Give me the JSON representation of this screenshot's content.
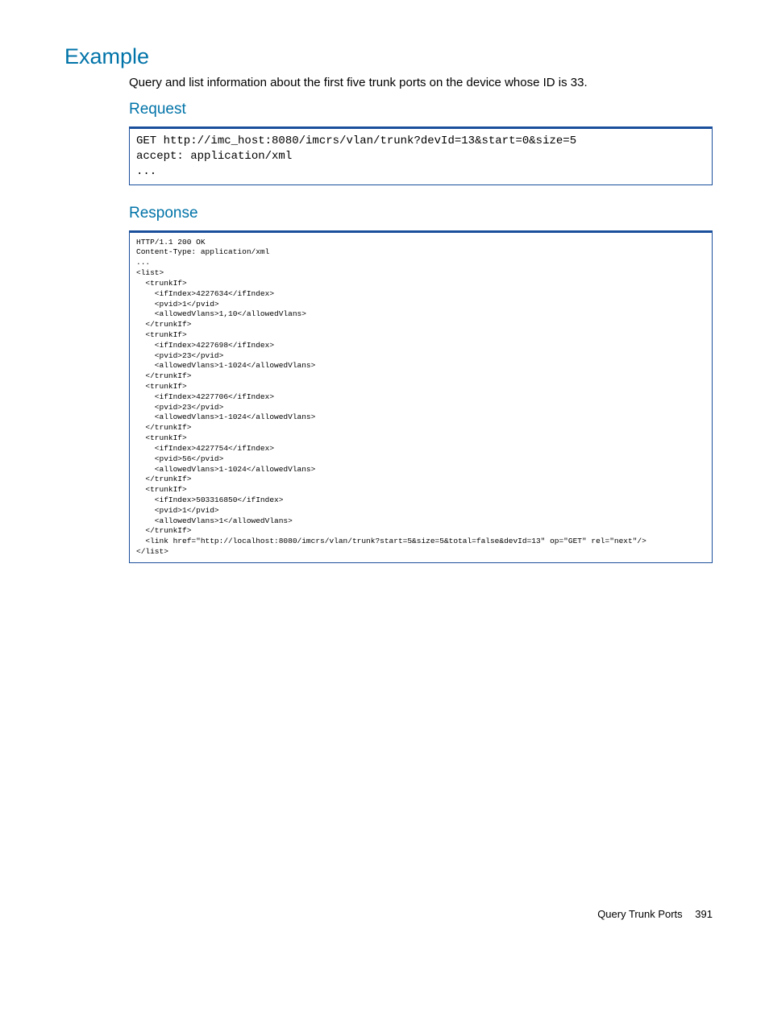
{
  "headings": {
    "example": "Example",
    "request": "Request",
    "response": "Response"
  },
  "intro": "Query and list information about the first five trunk ports on the device whose ID is 33.",
  "requestCode": "GET http://imc_host:8080/imcrs/vlan/trunk?devId=13&start=0&size=5\naccept: application/xml\n...",
  "responseCode": "HTTP/1.1 200 OK\nContent-Type: application/xml\n...\n<list>\n  <trunkIf>\n    <ifIndex>4227634</ifIndex>\n    <pvid>1</pvid>\n    <allowedVlans>1,10</allowedVlans>\n  </trunkIf>\n  <trunkIf>\n    <ifIndex>4227698</ifIndex>\n    <pvid>23</pvid>\n    <allowedVlans>1-1024</allowedVlans>\n  </trunkIf>\n  <trunkIf>\n    <ifIndex>4227706</ifIndex>\n    <pvid>23</pvid>\n    <allowedVlans>1-1024</allowedVlans>\n  </trunkIf>\n  <trunkIf>\n    <ifIndex>4227754</ifIndex>\n    <pvid>56</pvid>\n    <allowedVlans>1-1024</allowedVlans>\n  </trunkIf>\n  <trunkIf>\n    <ifIndex>503316850</ifIndex>\n    <pvid>1</pvid>\n    <allowedVlans>1</allowedVlans>\n  </trunkIf>\n  <link href=\"http://localhost:8080/imcrs/vlan/trunk?start=5&size=5&total=false&devId=13\" op=\"GET\" rel=\"next\"/>\n</list>",
  "footer": {
    "title": "Query Trunk Ports",
    "page": "391"
  }
}
